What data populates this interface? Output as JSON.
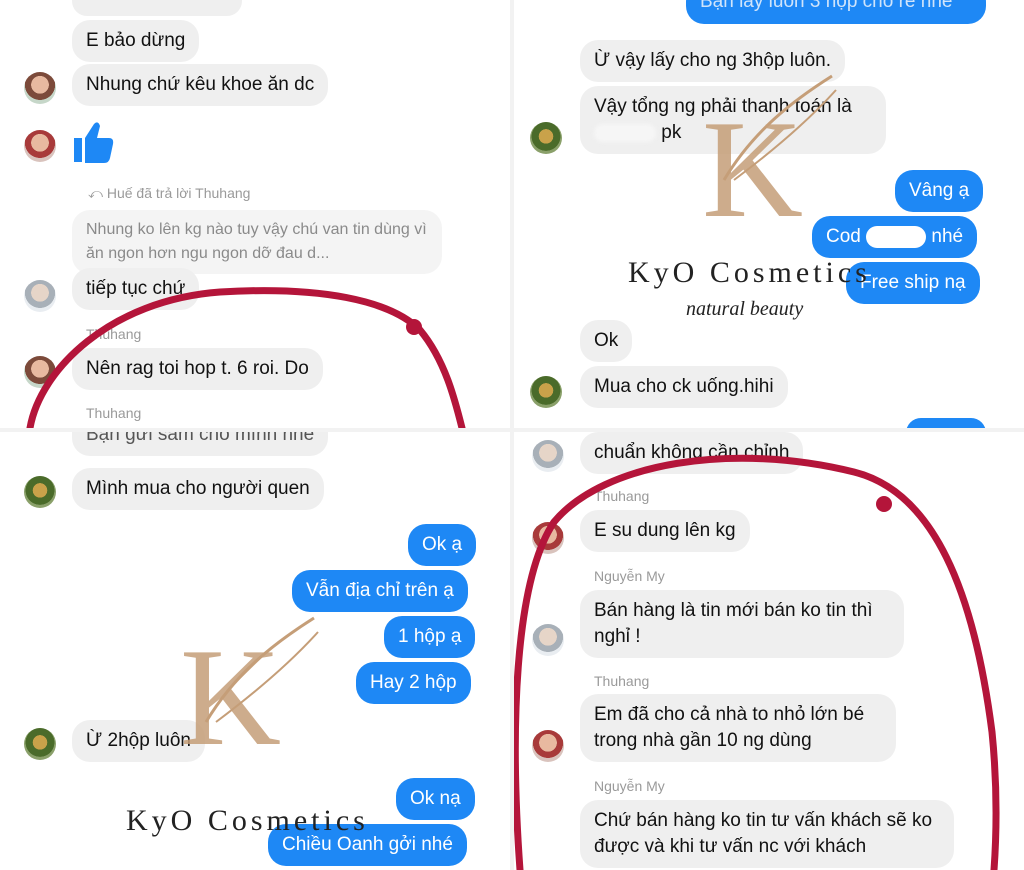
{
  "panel1": {
    "msg_top": "E bảo dừng",
    "msg_2": "Nhung chứ kêu khoe ăn dc",
    "reply_label": "Huế đã trả lời Thuhang",
    "quoted": "Nhung ko lên kg nào tuy vậy chú van tin dùng vì ăn ngon hơn ngu ngon dỡ đau d...",
    "msg_3": "tiếp tục chứ",
    "name_1": "Thuhang",
    "msg_4": "Nên rag toi hop t. 6 roi. Do",
    "name_2": "Thuhang"
  },
  "panel2": {
    "msg_out_top": "Bạn lấy luôn 3 hộp cho rẻ nhé",
    "msg_1": "Ừ vậy lấy cho ng 3hộp luôn.",
    "msg_2a": "Vậy tổng ng phải thanh toán là",
    "msg_2b": "pk",
    "out_1": "Vâng ạ",
    "out_2a": "Cod",
    "out_2b": "nhé",
    "out_3": "Free ship nạ",
    "msg_3": "Ok",
    "msg_4": "Mua cho ck uống.hihi"
  },
  "panel3": {
    "msg_top": "Bạn gửi sâm cho mình nhé",
    "msg_1": "Mình mua cho người quen",
    "out_1": "Ok ạ",
    "out_2": "Vẫn địa chỉ trên ạ",
    "out_3": "1 hộp ạ",
    "out_4": "Hay 2 hộp",
    "msg_2": "Ừ 2hộp luôn",
    "out_5": "Ok nạ",
    "out_6": "Chiều Oanh gởi nhé"
  },
  "panel4": {
    "msg_top": "chuẩn không cần chỉnh",
    "name_1": "Thuhang",
    "msg_1": "E su dung lên kg",
    "name_2": "Nguyễn My",
    "msg_2": "Bán hàng là tin mới bán ko tin thì nghỉ !",
    "name_3": "Thuhang",
    "msg_3": "Em đã cho cả nhà to nhỏ lớn bé trong nhà gần 10 ng dùng",
    "name_4": "Nguyễn My",
    "msg_4": "Chứ bán hàng ko tin tư vấn khách sẽ ko được và khi tư vấn nc với khách"
  },
  "watermark": {
    "letter": "K",
    "brand": "KyO Cosmetics",
    "tagline": "natural beauty"
  },
  "colors": {
    "outgoing_bubble": "#1e88f5",
    "incoming_bubble": "#efefef",
    "annotation_red": "#b4153a",
    "watermark_gold": "#c59e78"
  },
  "icons": {
    "reaction": "thumbs-up-icon",
    "reply": "reply-arrow-icon"
  }
}
